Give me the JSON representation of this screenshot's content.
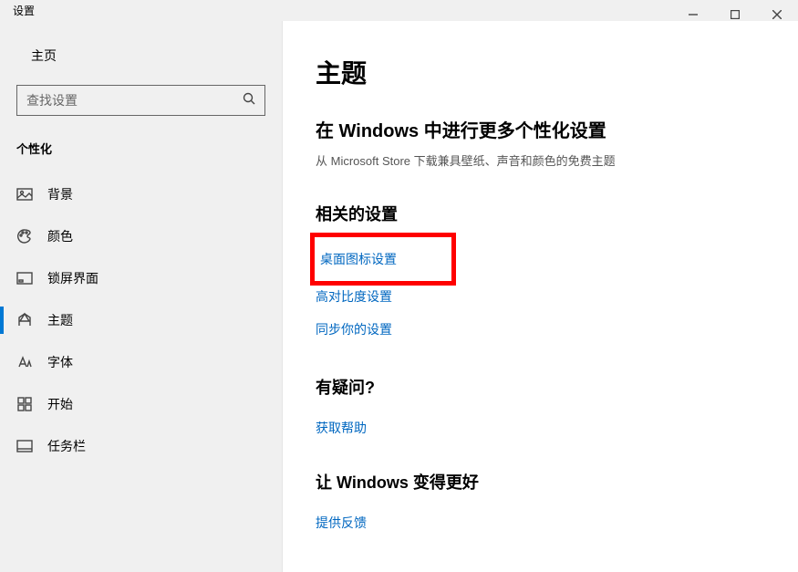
{
  "window": {
    "title": "设置"
  },
  "sidebar": {
    "home_label": "主页",
    "search_placeholder": "查找设置",
    "section_label": "个性化",
    "items": [
      {
        "label": "背景"
      },
      {
        "label": "颜色"
      },
      {
        "label": "锁屏界面"
      },
      {
        "label": "主题"
      },
      {
        "label": "字体"
      },
      {
        "label": "开始"
      },
      {
        "label": "任务栏"
      }
    ]
  },
  "content": {
    "heading": "主题",
    "more_heading": "在 Windows 中进行更多个性化设置",
    "more_text": "从 Microsoft Store 下载兼具壁纸、声音和颜色的免费主题",
    "related_heading": "相关的设置",
    "related_links": {
      "desktop_icon": "桌面图标设置",
      "high_contrast": "高对比度设置",
      "sync": "同步你的设置"
    },
    "question_heading": "有疑问?",
    "help_link": "获取帮助",
    "improve_heading": "让 Windows 变得更好",
    "feedback_link": "提供反馈"
  }
}
